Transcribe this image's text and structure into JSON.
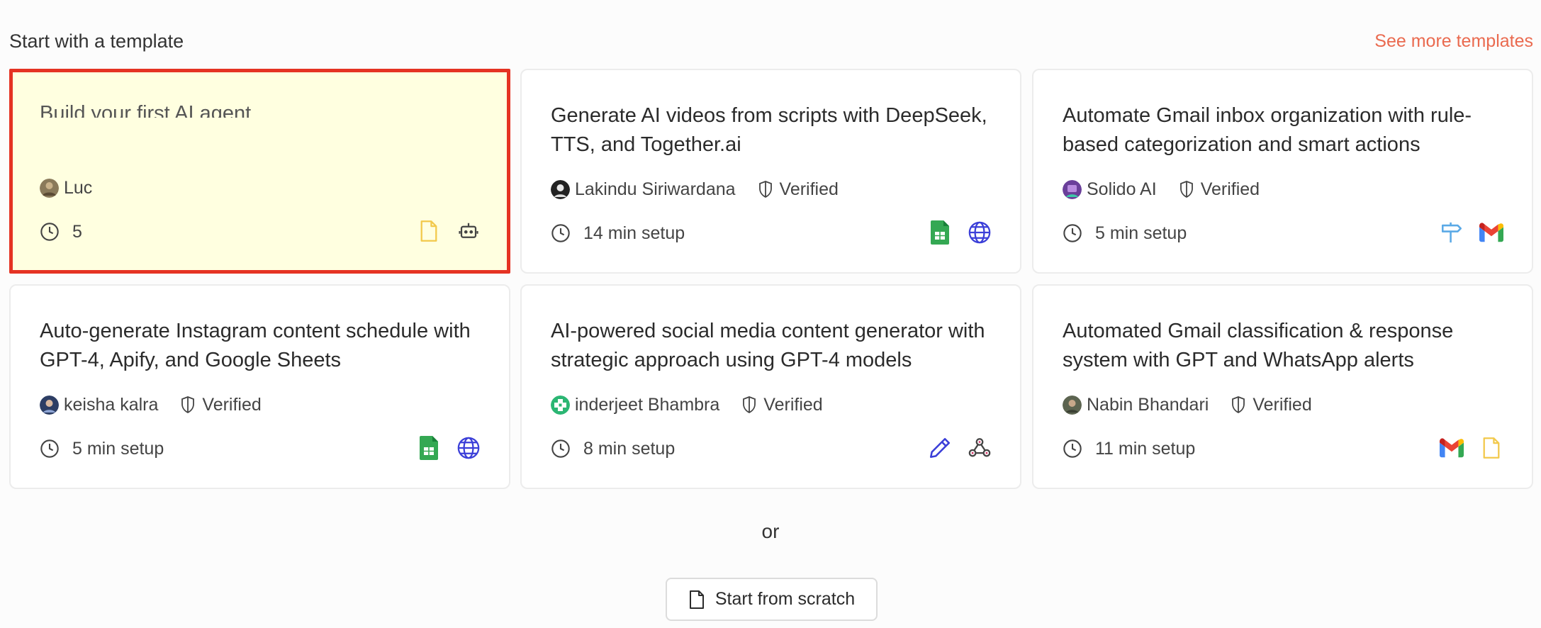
{
  "header": {
    "title": "Start with a template",
    "see_more": "See more templates"
  },
  "cards": [
    {
      "title": "Build your first AI agent",
      "author": "Luc",
      "verified": "",
      "setup": "5",
      "icons": [
        "file-yellow-icon",
        "robot-icon"
      ],
      "highlighted": true
    },
    {
      "title": "Generate AI videos from scripts with DeepSeek, TTS, and Together.ai",
      "author": "Lakindu Siriwardana",
      "verified": "Verified",
      "setup": "14 min setup",
      "icons": [
        "google-sheets-icon",
        "globe-icon"
      ]
    },
    {
      "title": "Automate Gmail inbox organization with rule-based categorization and smart actions",
      "author": "Solido AI",
      "verified": "Verified",
      "setup": "5 min setup",
      "icons": [
        "signpost-icon",
        "gmail-icon"
      ]
    },
    {
      "title": "Auto-generate Instagram content schedule with GPT-4, Apify, and Google Sheets",
      "author": "keisha kalra",
      "verified": "Verified",
      "setup": "5 min setup",
      "icons": [
        "google-sheets-icon",
        "globe-icon"
      ]
    },
    {
      "title": "AI-powered social media content generator with strategic approach using GPT-4 models",
      "author": "inderjeet Bhambra",
      "verified": "Verified",
      "setup": "8 min setup",
      "icons": [
        "pencil-icon",
        "webhook-icon"
      ]
    },
    {
      "title": "Automated Gmail classification & response system with GPT and WhatsApp alerts",
      "author": "Nabin Bhandari",
      "verified": "Verified",
      "setup": "11 min setup",
      "icons": [
        "gmail-icon",
        "file-yellow-icon"
      ]
    }
  ],
  "divider_text": "or",
  "scratch_button": "Start from scratch",
  "colors": {
    "accent": "#ea6a4f",
    "highlight_bg": "#ffffe0",
    "highlight_border": "#e53323",
    "sheets_green": "#34a853",
    "globe_blue": "#3b3fd8"
  }
}
